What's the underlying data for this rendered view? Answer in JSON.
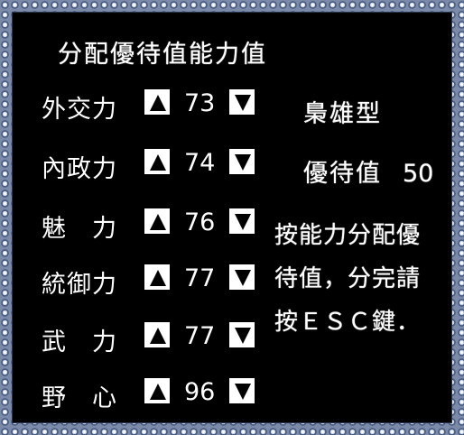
{
  "title": "分配優待值能力值",
  "stats": [
    {
      "label": "外交力",
      "value": "73"
    },
    {
      "label": "內政力",
      "value": "74"
    },
    {
      "label": "魅　力",
      "value": "76"
    },
    {
      "label": "統御力",
      "value": "77"
    },
    {
      "label": "武　力",
      "value": "77"
    },
    {
      "label": "野　心",
      "value": "96"
    }
  ],
  "character_type": "梟雄型",
  "bonus": {
    "label": "優待值",
    "value": "50"
  },
  "instructions": [
    "按能力分配優",
    "待值，分完請",
    "按ＥＳＣ鍵．"
  ],
  "colors": {
    "background": "#000000",
    "text": "#ffffff",
    "frame": "#7a8aa8"
  },
  "icons": {
    "increase": "triangle-up-icon",
    "decrease": "triangle-down-icon"
  }
}
